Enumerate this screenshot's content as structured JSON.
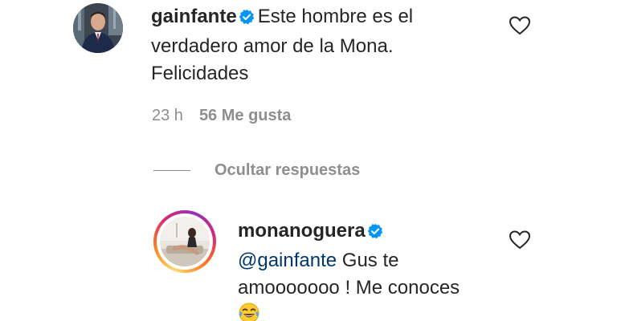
{
  "comment1": {
    "username": "gainfante",
    "text_line1": "Este hombre es el",
    "text_line2": "verdadero amor de la Mona.",
    "text_line3": "Felicidades",
    "time": "23 h",
    "likes": "56 Me gusta",
    "avatar_icon": "profile-photo-man-suit",
    "verified_icon": "verified-badge-icon",
    "like_icon": "heart-outline-icon"
  },
  "replies": {
    "toggle_label": "Ocultar respuestas"
  },
  "comment2": {
    "username": "monanoguera",
    "mention": "@gainfante",
    "text_line1_rest": " Gus te",
    "text_line2": "amooooooo ! Me conoces",
    "emoji": "face-with-tears-of-joy",
    "avatar_icon": "profile-photo-woman-seated",
    "verified_icon": "verified-badge-icon",
    "like_icon": "heart-outline-icon"
  },
  "colors": {
    "verified": "#0095f6",
    "text": "#262626",
    "secondary": "#8e8e8e",
    "mention": "#00376b"
  }
}
